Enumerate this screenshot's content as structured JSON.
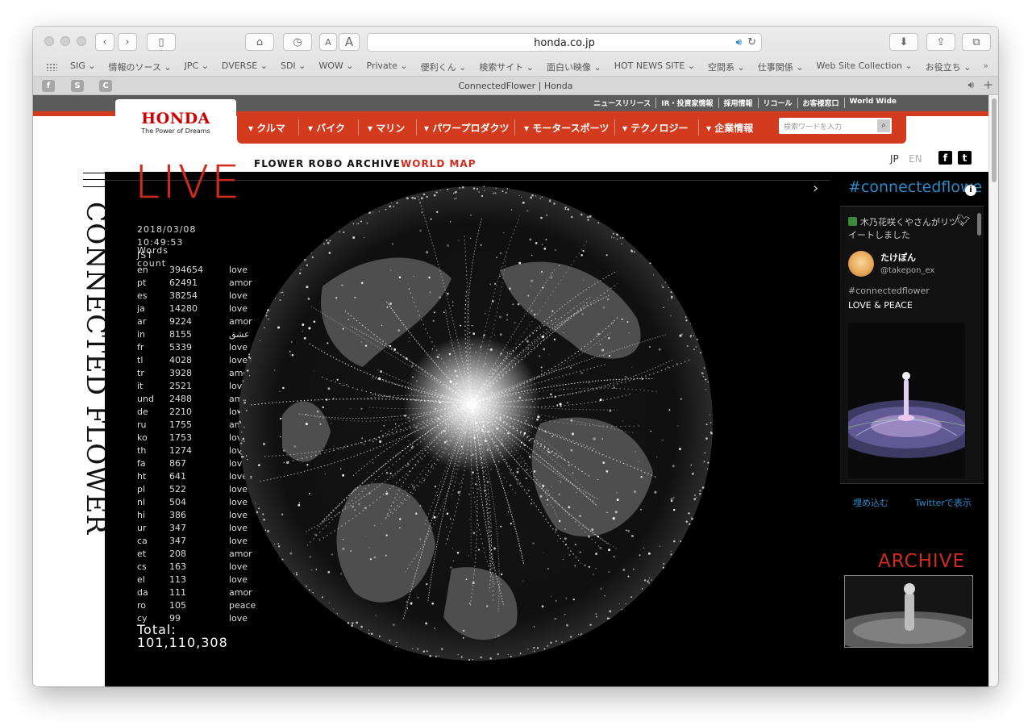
{
  "browser": {
    "url": "honda.co.jp",
    "tab_title": "ConnectedFlower | Honda",
    "bookmarks": [
      "SIG ⌄",
      "情報のソース ⌄",
      "JPC ⌄",
      "DVERSE ⌄",
      "SDI ⌄",
      "WOW ⌄",
      "Private ⌄",
      "便利くん ⌄",
      "検索サイト ⌄",
      "面白い映像 ⌄",
      "HOT NEWS SITE ⌄",
      "空間系 ⌄",
      "仕事関係 ⌄",
      "Web Site Collection ⌄",
      "お役立ち ⌄"
    ],
    "bookmarks_more": "»",
    "favicons": [
      "f",
      "S",
      "C"
    ],
    "font_small": "A",
    "font_large": "A",
    "add_tab": "+"
  },
  "header": {
    "utility_links": [
      "ニュースリリース",
      "IR・投資家情報",
      "採用情報",
      "リコール",
      "お客様窓口",
      "World Wide"
    ],
    "logo_text": "HONDA",
    "logo_tagline": "The Power of Dreams",
    "nav": [
      "▾ クルマ",
      "▾ バイク",
      "▾ マリン",
      "▾ パワープロダクツ",
      "▾ モータースポーツ",
      "▾ テクノロジー",
      "▾ 企業情報"
    ],
    "search_placeholder": "検索ワードを入力"
  },
  "site": {
    "vertical_title": "CONNECTED FLOWER",
    "live_label": "LIVE",
    "subnav": {
      "archive": "FLOWER ROBO ARCHIVE",
      "map": "WORLD MAP"
    },
    "lang": {
      "jp": "JP",
      "en": "EN"
    },
    "social": {
      "facebook": "f",
      "twitter": "t"
    }
  },
  "stats": {
    "timestamp": "2018/03/08 10:49:53 JST",
    "words_count_label": "Words count",
    "rows": [
      [
        "en",
        "394654",
        "love"
      ],
      [
        "pt",
        "62491",
        "amor"
      ],
      [
        "es",
        "38254",
        "love"
      ],
      [
        "ja",
        "14280",
        "love"
      ],
      [
        "ar",
        "9224",
        "amor"
      ],
      [
        "in",
        "8155",
        "عشق"
      ],
      [
        "fr",
        "5339",
        "love"
      ],
      [
        "tl",
        "4028",
        "love"
      ],
      [
        "tr",
        "3928",
        "amor"
      ],
      [
        "it",
        "2521",
        "love"
      ],
      [
        "und",
        "2488",
        "amor"
      ],
      [
        "de",
        "2210",
        "love"
      ],
      [
        "ru",
        "1755",
        "amor"
      ],
      [
        "ko",
        "1753",
        "love"
      ],
      [
        "th",
        "1274",
        "love"
      ],
      [
        "fa",
        "867",
        "love"
      ],
      [
        "ht",
        "641",
        "love"
      ],
      [
        "pl",
        "522",
        "love"
      ],
      [
        "nl",
        "504",
        "love"
      ],
      [
        "hi",
        "386",
        "love"
      ],
      [
        "ur",
        "347",
        "love"
      ],
      [
        "ca",
        "347",
        "love"
      ],
      [
        "et",
        "208",
        "amor"
      ],
      [
        "cs",
        "163",
        "love"
      ],
      [
        "el",
        "113",
        "love"
      ],
      [
        "da",
        "111",
        "amor"
      ],
      [
        "ro",
        "105",
        "peace"
      ],
      [
        "cy",
        "99",
        "love"
      ]
    ],
    "total": "Total: 101,110,308"
  },
  "sidebar": {
    "hashtag": "#connectedflower",
    "info_icon": "i",
    "tweet": {
      "retweet_text": "木乃花咲くやさんがリツイートしました",
      "name": "たけぽん",
      "handle": "@takepon_ex",
      "hashtag": "#connectedflower",
      "message": "LOVE & PEACE"
    },
    "embed_label": "埋め込む",
    "view_on_twitter": "Twitterで表示",
    "archive_label": "ARCHIVE"
  },
  "icons": {
    "back": "back-arrow-icon",
    "forward": "forward-arrow-icon",
    "sidebar": "sidebar-icon",
    "home": "home-icon",
    "history": "history-clock-icon",
    "audio": "speaker-icon",
    "reload": "reload-icon",
    "download": "download-icon",
    "share": "share-icon",
    "tabs": "tabs-icon",
    "twitter": "twitter-bird-icon",
    "next": "chevron-right-icon"
  },
  "colors": {
    "brand_red": "#d23b1e",
    "accent_blue": "#2b89c8",
    "globe_bg": "#000000"
  }
}
